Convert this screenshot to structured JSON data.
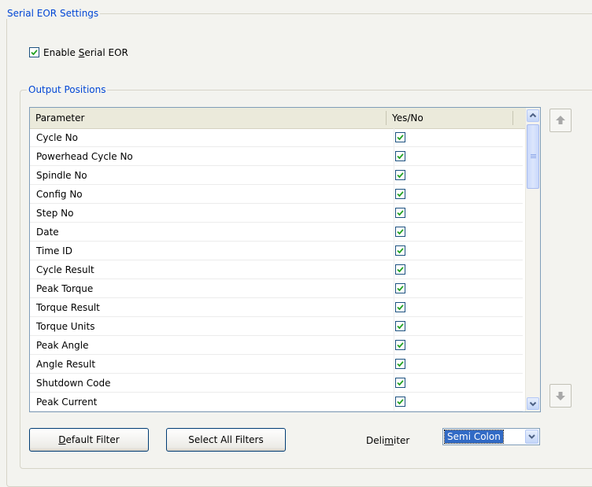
{
  "serial_eor": {
    "group_title": "Serial EOR Settings",
    "enable_label_pre": "Enable ",
    "enable_label_key": "S",
    "enable_label_post": "erial EOR",
    "enable_checked": true
  },
  "output_positions": {
    "group_title": "Output Positions",
    "columns": {
      "parameter": "Parameter",
      "yes_no": "Yes/No"
    },
    "rows": [
      {
        "parameter": "Cycle No",
        "checked": true
      },
      {
        "parameter": "Powerhead Cycle No",
        "checked": true
      },
      {
        "parameter": "Spindle No",
        "checked": true
      },
      {
        "parameter": "Config No",
        "checked": true
      },
      {
        "parameter": "Step No",
        "checked": true
      },
      {
        "parameter": "Date",
        "checked": true
      },
      {
        "parameter": "Time ID",
        "checked": true
      },
      {
        "parameter": "Cycle Result",
        "checked": true
      },
      {
        "parameter": "Peak Torque",
        "checked": true
      },
      {
        "parameter": "Torque Result",
        "checked": true
      },
      {
        "parameter": "Torque Units",
        "checked": true
      },
      {
        "parameter": "Peak Angle",
        "checked": true
      },
      {
        "parameter": "Angle Result",
        "checked": true
      },
      {
        "parameter": "Shutdown Code",
        "checked": true
      },
      {
        "parameter": "Peak Current",
        "checked": true
      }
    ]
  },
  "buttons": {
    "default_filter_key": "D",
    "default_filter_rest": "efault Filter",
    "select_all_filters": "Select All Filters"
  },
  "delimiter": {
    "label_pre": "Deli",
    "label_key": "m",
    "label_post": "iter",
    "selected": "Semi Colon"
  },
  "colors": {
    "group_title": "#0046d5",
    "selection": "#316ac5",
    "check_mark": "#21a121"
  }
}
